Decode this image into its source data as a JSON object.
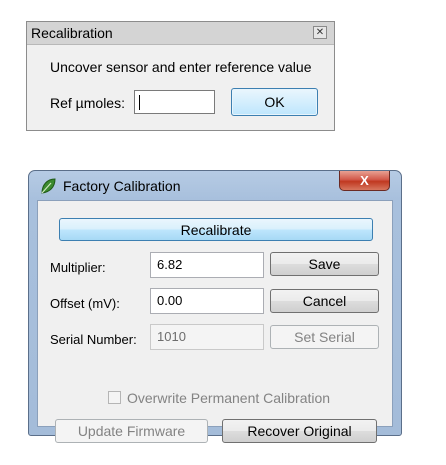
{
  "recalibration": {
    "title": "Recalibration",
    "message": "Uncover sensor and enter reference value",
    "ref_label": "Ref µmoles:",
    "ref_value": "",
    "ok_label": "OK"
  },
  "factory": {
    "title": "Factory Calibration",
    "close_label": "X",
    "recalibrate_label": "Recalibrate",
    "multiplier_label": "Multiplier:",
    "multiplier_value": "6.82",
    "save_label": "Save",
    "offset_label": "Offset (mV):",
    "offset_value": "0.00",
    "cancel_label": "Cancel",
    "serial_label": "Serial Number:",
    "serial_value": "1010",
    "set_serial_label": "Set Serial",
    "overwrite_label": "Overwrite Permanent Calibration",
    "overwrite_checked": false,
    "update_firmware_label": "Update Firmware",
    "recover_original_label": "Recover Original"
  },
  "colors": {
    "dialog_bg": "#f0f0f0",
    "aero_frame": "#a8c0dd",
    "close_red": "#c03820",
    "focus_blue": "#3c7fb1"
  }
}
